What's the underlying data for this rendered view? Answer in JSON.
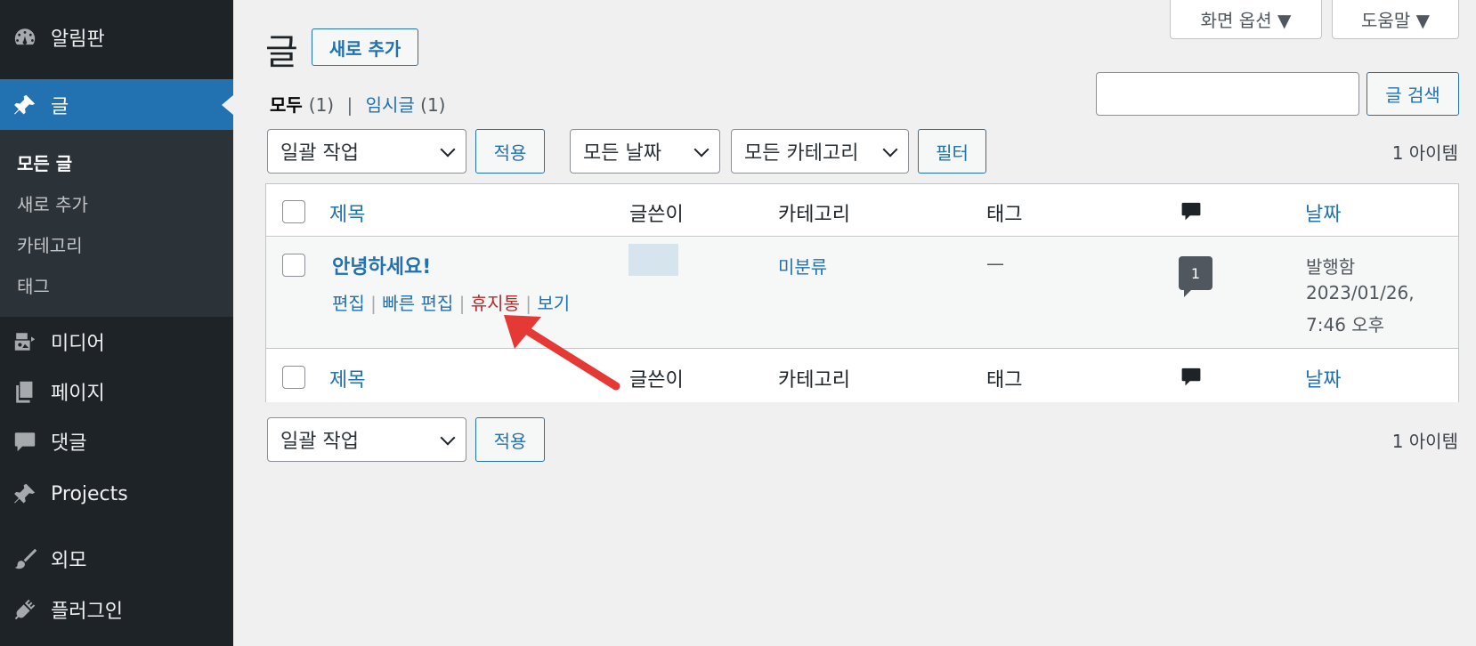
{
  "sidebar": {
    "items": [
      {
        "label": "알림판",
        "icon": "dashboard-icon"
      },
      {
        "label": "글",
        "icon": "pin-icon",
        "current": true
      },
      {
        "label": "미디어",
        "icon": "media-icon"
      },
      {
        "label": "페이지",
        "icon": "pages-icon"
      },
      {
        "label": "댓글",
        "icon": "comments-icon"
      },
      {
        "label": "Projects",
        "icon": "pin-icon"
      },
      {
        "label": "외모",
        "icon": "brush-icon"
      },
      {
        "label": "플러그인",
        "icon": "plugin-icon"
      }
    ],
    "submenu": [
      "모든 글",
      "새로 추가",
      "카테고리",
      "태그"
    ]
  },
  "header": {
    "title": "글",
    "add_new": "새로 추가",
    "screen_options": "화면 옵션 ▼",
    "help": "도움말 ▼"
  },
  "views": {
    "all_label": "모두",
    "all_count": "(1)",
    "separator": "|",
    "draft_label": "임시글",
    "draft_count": "(1)"
  },
  "search": {
    "button": "글 검색",
    "value": ""
  },
  "tablenav_top": {
    "bulk_action": "일괄 작업",
    "apply": "적용",
    "date_filter": "모든 날짜",
    "category_filter": "모든 카테고리",
    "filter": "필터",
    "count": "1 아이템"
  },
  "table": {
    "columns": {
      "title": "제목",
      "author": "글쓴이",
      "categories": "카테고리",
      "tags": "태그",
      "comments_icon": "comment-bubble-icon",
      "date": "날짜"
    },
    "rows": [
      {
        "title": "안녕하세요!",
        "category": "미분류",
        "tags": "—",
        "comments": "1",
        "date_status": "발행함",
        "date_line1": "2023/01/26,",
        "date_line2": "7:46 오후",
        "actions": {
          "edit": "편집",
          "quick_edit": "빠른 편집",
          "trash": "휴지통",
          "view": "보기",
          "sep": "|"
        }
      }
    ]
  },
  "tablenav_bottom": {
    "bulk_action": "일괄 작업",
    "apply": "적용",
    "count": "1 아이템"
  },
  "colors": {
    "sidebar_bg": "#1d2327",
    "accent": "#2271b1",
    "trash": "#b32d2e",
    "annotation_arrow": "#e53935"
  }
}
